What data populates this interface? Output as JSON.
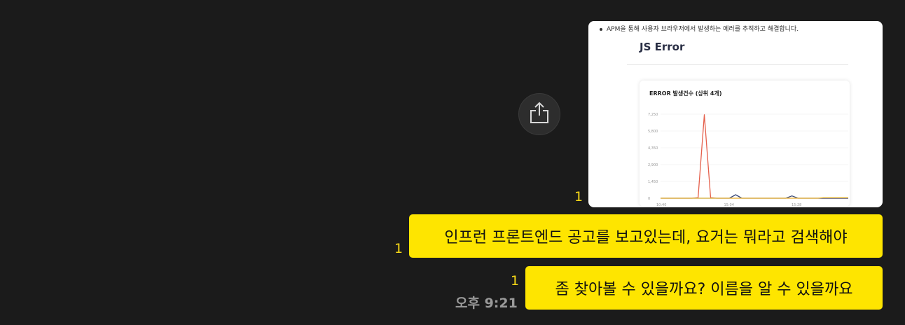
{
  "image_card": {
    "bullet_text": "APM을 통해 사용자 브라우저에서 발생하는 에러를 추적하고 해결합니다.",
    "section_title": "JS Error",
    "chart_title": "ERROR 발생건수 (상위 4개)",
    "chart_data": {
      "type": "line",
      "y_ticks": [
        "7,250",
        "5,800",
        "4,350",
        "2,900",
        "1,450",
        "0"
      ],
      "x_ticks": [
        "10:40",
        "15:04",
        "15:28"
      ],
      "ylim": [
        0,
        7250
      ],
      "x": [
        0,
        1,
        2,
        3,
        4,
        5,
        6,
        7,
        8,
        9,
        10,
        11,
        12,
        13,
        14,
        15,
        16,
        17,
        18,
        19,
        20,
        21,
        22,
        23,
        24,
        25,
        26,
        27,
        28,
        29,
        30
      ],
      "series": [
        {
          "color": "#e5604c",
          "values": [
            0,
            0,
            0,
            0,
            0,
            0,
            50,
            7200,
            50,
            0,
            0,
            0,
            0,
            0,
            0,
            0,
            0,
            0,
            0,
            0,
            0,
            0,
            0,
            0,
            0,
            0,
            0,
            0,
            0,
            0,
            0
          ]
        },
        {
          "color": "#3b4a7a",
          "values": [
            0,
            0,
            0,
            0,
            0,
            0,
            0,
            0,
            0,
            0,
            0,
            0,
            300,
            0,
            0,
            0,
            0,
            0,
            0,
            0,
            0,
            200,
            0,
            0,
            0,
            0,
            0,
            0,
            0,
            0,
            0
          ]
        },
        {
          "color": "#f0c341",
          "values": [
            0,
            0,
            0,
            0,
            0,
            0,
            0,
            0,
            0,
            0,
            0,
            0,
            0,
            0,
            0,
            0,
            0,
            0,
            0,
            0,
            0,
            0,
            0,
            0,
            0,
            0,
            50,
            50,
            50,
            50,
            50
          ]
        }
      ]
    }
  },
  "messages": [
    {
      "read_count": "1",
      "text": "인프런 프론트엔드 공고를 보고있는데, 요거는 뭐라고 검색해야"
    },
    {
      "read_count": "1",
      "text": "좀 찾아볼 수 있을까요? 이름을 알 수 있을까요"
    }
  ],
  "image_read_count": "1",
  "timestamp": "오후 9:21",
  "icons": {
    "share": "share-icon"
  }
}
